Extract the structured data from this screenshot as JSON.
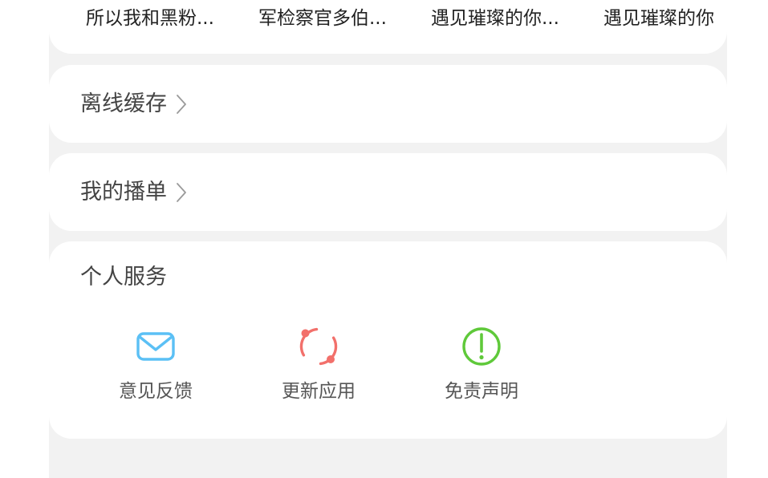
{
  "history": {
    "items": [
      {
        "label": "所以我和黑粉..."
      },
      {
        "label": "军检察官多伯..."
      },
      {
        "label": "遇见璀璨的你..."
      },
      {
        "label": "遇见璀璨的你"
      }
    ]
  },
  "menu": {
    "offline_cache": "离线缓存",
    "my_playlist": "我的播单"
  },
  "services": {
    "title": "个人服务",
    "items": [
      {
        "label": "意见反馈",
        "icon": "mail-icon",
        "color": "#5bc0f5"
      },
      {
        "label": "更新应用",
        "icon": "refresh-icon",
        "color": "#f2706b"
      },
      {
        "label": "免责声明",
        "icon": "exclamation-icon",
        "color": "#5fc93a"
      }
    ]
  }
}
